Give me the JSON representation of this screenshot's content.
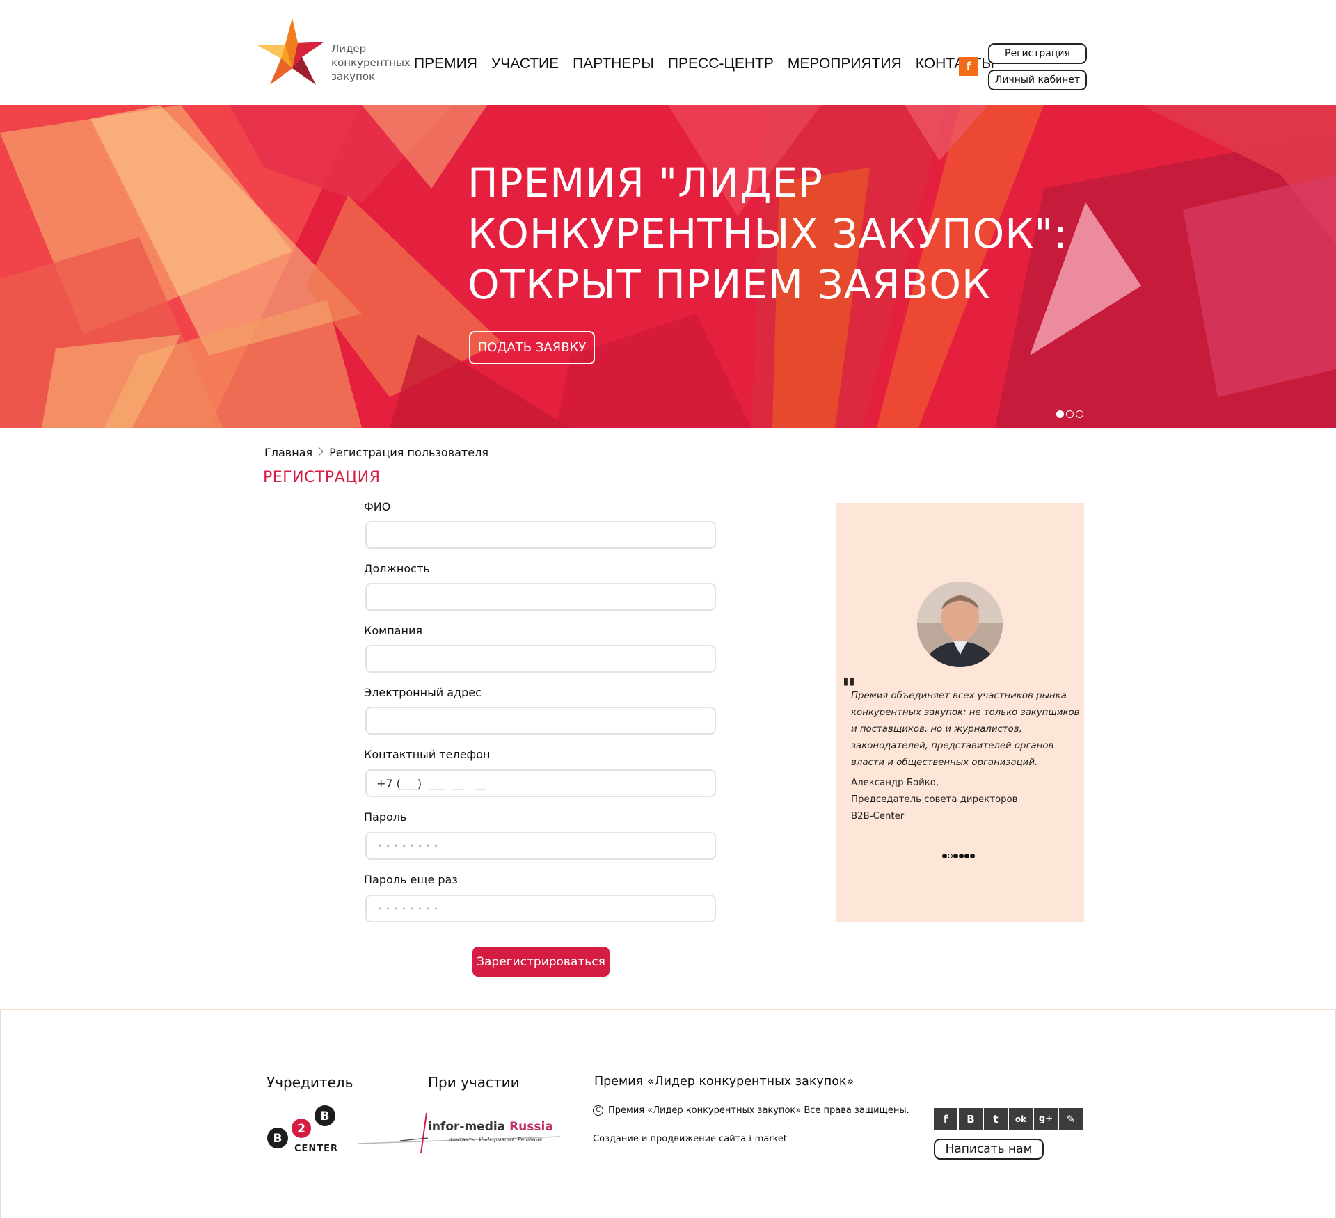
{
  "header": {
    "logo_lines": [
      "Лидер",
      "конкурентных",
      "закупок"
    ],
    "nav": [
      "ПРЕМИЯ",
      "УЧАСТИЕ",
      "ПАРТНЕРЫ",
      "ПРЕСС-ЦЕНТР",
      "МЕРОПРИЯТИЯ",
      "КОНТАКТЫ"
    ],
    "facebook_glyph": "f",
    "register_label": "Регистрация",
    "cabinet_label": "Личный кабинет"
  },
  "hero": {
    "title_lines": [
      "ПРЕМИЯ \"ЛИДЕР",
      "КОНКУРЕНТНЫХ ЗАКУПОК\":",
      "ОТКРЫТ ПРИЕМ ЗАЯВОК"
    ],
    "button_label": "ПОДАТЬ ЗАЯВКУ",
    "slides_total": 3,
    "slide_active": 1
  },
  "breadcrumb": {
    "home": "Главная",
    "current": "Регистрация пользователя"
  },
  "page_title": "РЕГИСТРАЦИЯ",
  "form": {
    "fio_label": "ФИО",
    "position_label": "Должность",
    "company_label": "Компания",
    "email_label": "Электронный адрес",
    "phone_label": "Контактный телефон",
    "phone_placeholder": "+7 (___)  ___  __   __",
    "password_label": "Пароль",
    "password_repeat_label": "Пароль еще раз",
    "password_mask": "••••••••",
    "submit_label": "Зарегистрироваться"
  },
  "quote": {
    "mark": "\"",
    "text": "Премия объединяет всех участников рынка конкурентных закупок: не только закупщиков и поставщиков,  но и журналистов, законодателей, представителей органов власти и общественных организаций.",
    "author_name": "Александр Бойко,",
    "author_role": "Председатель совета директоров",
    "author_company": "B2B-Center",
    "dots_total": 6,
    "dot_active": 2
  },
  "footer": {
    "founder_title": "Учредитель",
    "founder_logo_text": "CENTER",
    "participation_title": "При участии",
    "partner_logo_main": "infor-media",
    "partner_logo_accent": "Russia",
    "partner_logo_sub": "Контакты. Информация. Решения.",
    "award_title": "Премия «Лидер конкурентных закупок»",
    "copyright": "Премия «Лидер конкурентных закупок» Все права защищены.",
    "credits": "Создание и продвижение сайта i-market",
    "social": [
      "f",
      "В",
      "t",
      "ok",
      "g+",
      "✎"
    ],
    "write_label": "Написать нам"
  },
  "colors": {
    "accent": "#d51d44",
    "orange": "#f26b16",
    "panel": "#fde5d8"
  }
}
